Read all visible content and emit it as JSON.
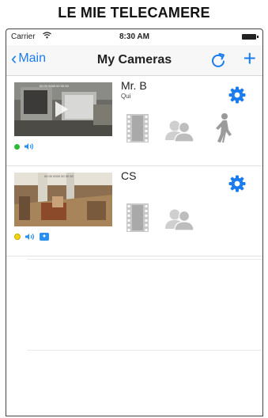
{
  "page": {
    "title": "LE MIE TELECAMERE"
  },
  "statusbar": {
    "carrier": "Carrier",
    "time": "8:30 AM"
  },
  "navbar": {
    "back_label": "Main",
    "title": "My Cameras",
    "add_label": "+"
  },
  "cameras": [
    {
      "name": "Mr. B",
      "subtitle": "Qui",
      "online_status": "green",
      "indicators": [
        "sound-icon"
      ],
      "actions": [
        "video-clips-icon",
        "contacts-icon",
        "motion-detection-icon"
      ]
    },
    {
      "name": "CS",
      "subtitle": "",
      "online_status": "yellow",
      "indicators": [
        "sound-icon",
        "alert-badge-icon"
      ],
      "actions": [
        "video-clips-icon",
        "contacts-icon"
      ]
    }
  ],
  "colors": {
    "accent": "#1a7cf0",
    "online": "#2cbb39",
    "connecting": "#f2d312"
  }
}
